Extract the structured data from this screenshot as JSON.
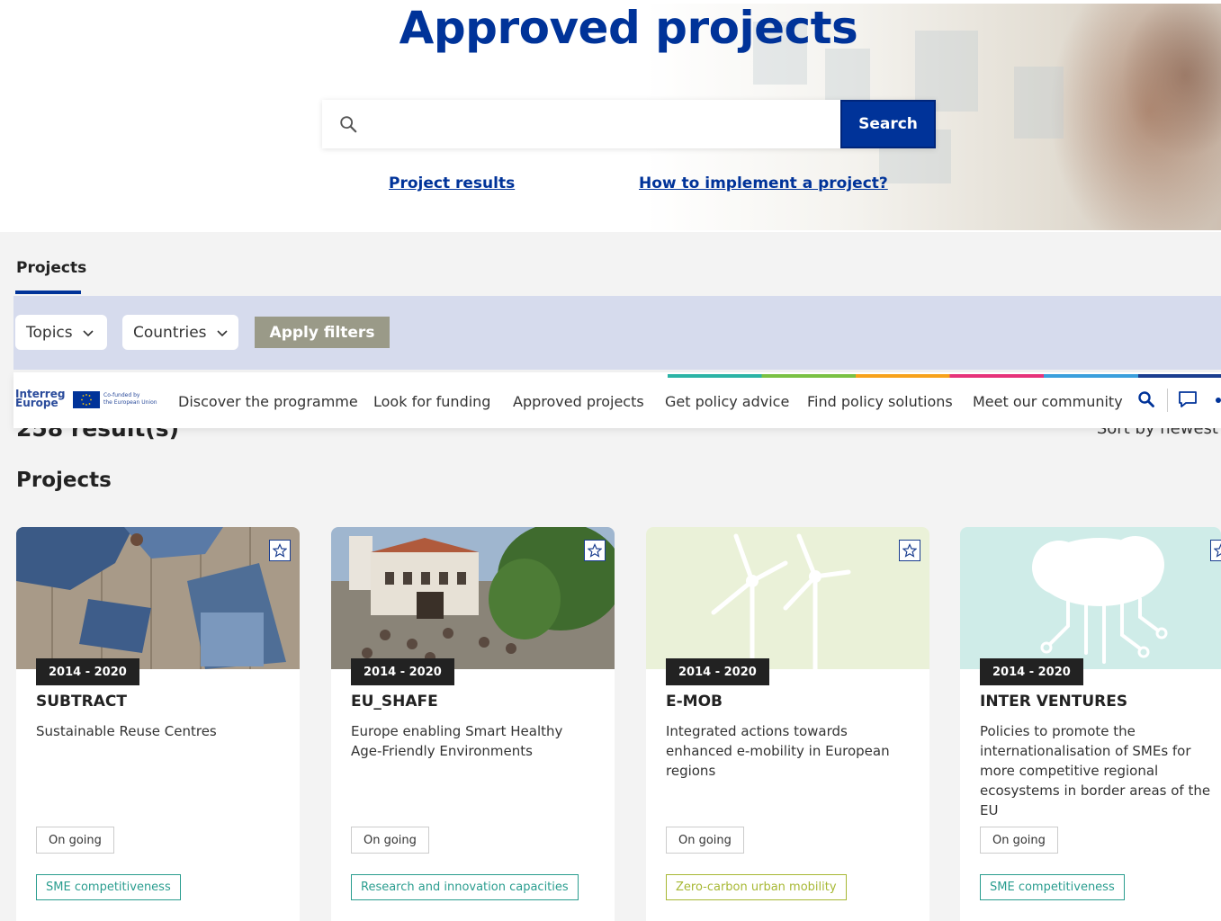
{
  "hero": {
    "title": "Approved projects",
    "search_placeholder": "",
    "search_button": "Search",
    "links": [
      "Project results",
      "How to implement a project?"
    ]
  },
  "tabs": {
    "projects": "Projects"
  },
  "filters": {
    "topics": "Topics",
    "countries": "Countries",
    "apply": "Apply filters"
  },
  "nav": {
    "logo_word": "Interreg\nEurope",
    "logo_cofund": "Co-funded by\nthe European Union",
    "items": [
      "Discover the programme",
      "Look for funding",
      "Approved projects",
      "Get policy advice",
      "Find policy solutions",
      "Meet our community"
    ],
    "icons": [
      "search-icon",
      "chat-icon"
    ]
  },
  "results": {
    "count": "258 result(s)",
    "sort": "Sort by newest"
  },
  "section_title": "Projects",
  "cards": [
    {
      "period": "2014 - 2020",
      "acronym": "SUBTRACT",
      "description": "Sustainable Reuse Centres",
      "status": "On going",
      "topic": "SME competitiveness",
      "topic_color": "#2a9d8f"
    },
    {
      "period": "2014 - 2020",
      "acronym": "EU_SHAFE",
      "description": "Europe enabling Smart Healthy Age-Friendly Environments",
      "status": "On going",
      "topic": "Research and innovation capacities",
      "topic_color": "#2a9d8f"
    },
    {
      "period": "2014 - 2020",
      "acronym": "E-MOB",
      "description": "Integrated actions towards enhanced e-mobility in European regions",
      "status": "On going",
      "topic": "Zero-carbon urban mobility",
      "topic_color": "#a7b834"
    },
    {
      "period": "2014 - 2020",
      "acronym": "INTER VENTURES",
      "description": "Policies to promote the internationalisation of SMEs for more competitive regional ecosystems in border areas of the EU",
      "status": "On going",
      "topic": "SME competitiveness",
      "topic_color": "#2a9d8f"
    }
  ],
  "colors": {
    "brand": "#003399",
    "filter_bar": "#d6dbed",
    "apply_button": "#9a9a88"
  }
}
